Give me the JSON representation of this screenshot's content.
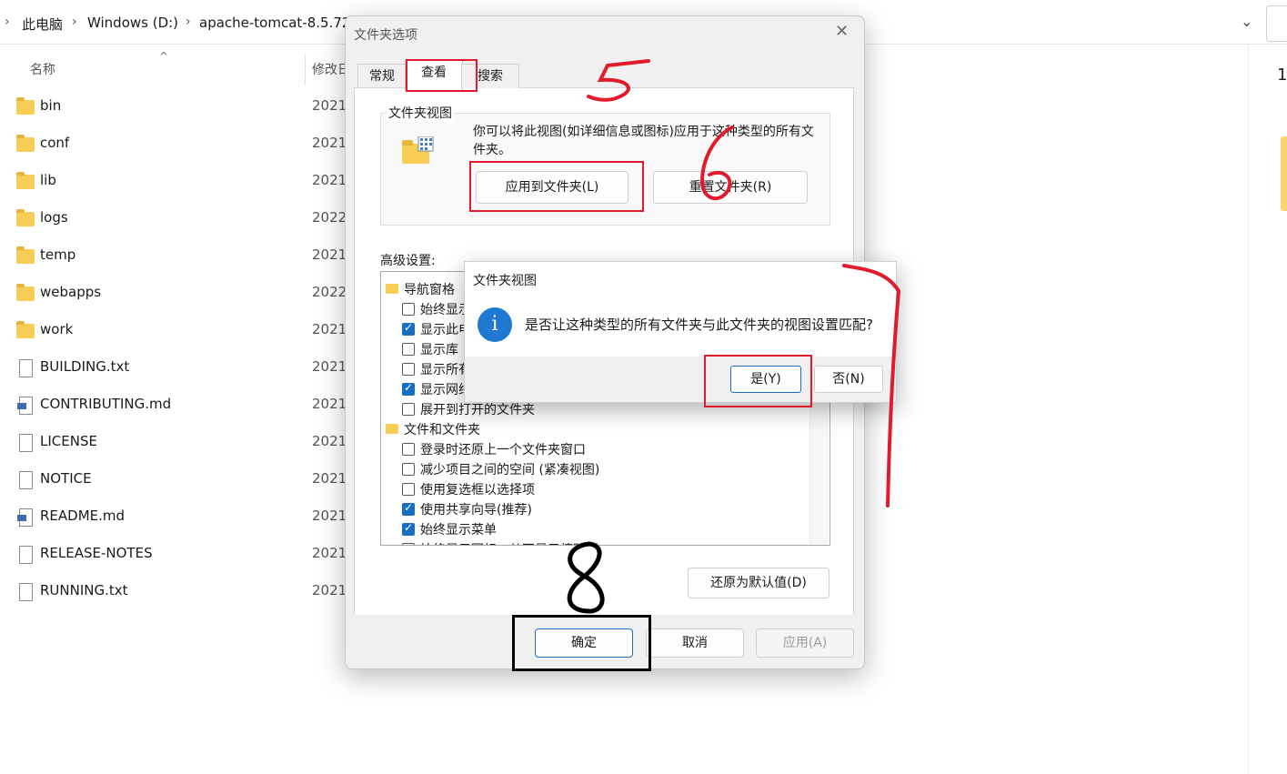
{
  "explorer": {
    "breadcrumb": [
      "此电脑",
      "Windows (D:)",
      "apache-tomcat-8.5.72"
    ],
    "columns": {
      "name": "名称",
      "modified": "修改日"
    },
    "right_number": "1",
    "files": [
      {
        "name": "bin",
        "type": "folder",
        "date": "2021"
      },
      {
        "name": "conf",
        "type": "folder",
        "date": "2021"
      },
      {
        "name": "lib",
        "type": "folder",
        "date": "2021"
      },
      {
        "name": "logs",
        "type": "folder",
        "date": "2022"
      },
      {
        "name": "temp",
        "type": "folder",
        "date": "2021"
      },
      {
        "name": "webapps",
        "type": "folder",
        "date": "2022"
      },
      {
        "name": "work",
        "type": "folder",
        "date": "2021"
      },
      {
        "name": "BUILDING.txt",
        "type": "text",
        "date": "2021"
      },
      {
        "name": "CONTRIBUTING.md",
        "type": "markdown",
        "date": "2021"
      },
      {
        "name": "LICENSE",
        "type": "file",
        "date": "2021"
      },
      {
        "name": "NOTICE",
        "type": "file",
        "date": "2021"
      },
      {
        "name": "README.md",
        "type": "markdown",
        "date": "2021"
      },
      {
        "name": "RELEASE-NOTES",
        "type": "file",
        "date": "2021"
      },
      {
        "name": "RUNNING.txt",
        "type": "text",
        "date": "2021"
      }
    ]
  },
  "folder_options": {
    "title": "文件夹选项",
    "tabs": {
      "general": "常规",
      "view": "查看",
      "search": "搜索"
    },
    "folder_view": {
      "group_label": "文件夹视图",
      "description": "你可以将此视图(如详细信息或图标)应用于这种类型的所有文件夹。",
      "apply_button": "应用到文件夹(L)",
      "reset_button": "重置文件夹(R)"
    },
    "advanced_label": "高级设置:",
    "tree": [
      {
        "kind": "category",
        "label": "导航窗格"
      },
      {
        "kind": "check",
        "label": "始终显示",
        "checked": false
      },
      {
        "kind": "check",
        "label": "显示此电",
        "checked": true
      },
      {
        "kind": "check",
        "label": "显示库",
        "checked": false
      },
      {
        "kind": "check",
        "label": "显示所有",
        "checked": false
      },
      {
        "kind": "check",
        "label": "显示网络",
        "checked": true
      },
      {
        "kind": "check",
        "label": "展开到打开的文件夹",
        "checked": false
      },
      {
        "kind": "category",
        "label": "文件和文件夹"
      },
      {
        "kind": "check",
        "label": "登录时还原上一个文件夹窗口",
        "checked": false
      },
      {
        "kind": "check",
        "label": "减少项目之间的空间 (紧凑视图)",
        "checked": false
      },
      {
        "kind": "check",
        "label": "使用复选框以选择项",
        "checked": false
      },
      {
        "kind": "check",
        "label": "使用共享向导(推荐)",
        "checked": true
      },
      {
        "kind": "check",
        "label": "始终显示菜单",
        "checked": true
      },
      {
        "kind": "check",
        "label": "始终显示图标，从不显示缩略图",
        "checked": false
      }
    ],
    "restore_defaults": "还原为默认值(D)",
    "ok": "确定",
    "cancel": "取消",
    "apply": "应用(A)"
  },
  "confirm_popup": {
    "title": "文件夹视图",
    "message": "是否让这种类型的所有文件夹与此文件夹的视图设置匹配?",
    "yes": "是(Y)",
    "no": "否(N)"
  },
  "annotation_colors": {
    "red": "#e11b2b",
    "black": "#000000"
  }
}
